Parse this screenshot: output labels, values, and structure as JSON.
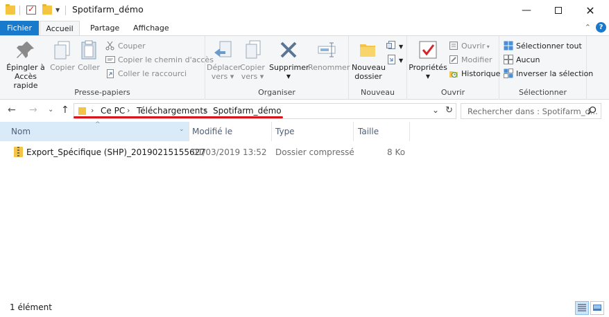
{
  "window": {
    "title": "Spotifarm_démo",
    "minimize_icon": "minimize-icon",
    "maximize_icon": "maximize-icon",
    "close_icon": "close-icon"
  },
  "ribbon_tabs": {
    "file": "Fichier",
    "home": "Accueil",
    "share": "Partage",
    "view": "Affichage"
  },
  "ribbon": {
    "clipboard": {
      "label": "Presse-papiers",
      "pin_line1": "Épingler à",
      "pin_line2": "Accès rapide",
      "copy": "Copier",
      "paste": "Coller",
      "cut": "Couper",
      "copy_path": "Copier le chemin d'accès",
      "paste_shortcut": "Coller le raccourci"
    },
    "organize": {
      "label": "Organiser",
      "move_line1": "Déplacer",
      "move_line2": "vers",
      "copyto_line1": "Copier",
      "copyto_line2": "vers",
      "delete": "Supprimer",
      "rename": "Renommer"
    },
    "new": {
      "label": "Nouveau",
      "new_folder_line1": "Nouveau",
      "new_folder_line2": "dossier"
    },
    "open": {
      "label": "Ouvrir",
      "properties": "Propriétés",
      "open": "Ouvrir",
      "edit": "Modifier",
      "history": "Historique"
    },
    "select": {
      "label": "Sélectionner",
      "select_all": "Sélectionner tout",
      "select_none": "Aucun",
      "invert": "Inverser la sélection"
    }
  },
  "address_bar": {
    "breadcrumb": [
      "Ce PC",
      "Téléchargements",
      "Spotifarm_démo"
    ],
    "search_placeholder": "Rechercher dans : Spotifarm_d..."
  },
  "columns": {
    "name": "Nom",
    "modified": "Modifié le",
    "type": "Type",
    "size": "Taille"
  },
  "files": [
    {
      "name": "Export_Spécifique (SHP)_20190215155627",
      "modified": "01/03/2019 13:52",
      "type": "Dossier compressé",
      "size": "8 Ko",
      "icon": "zip-folder-icon"
    }
  ],
  "status_bar": {
    "count": "1 élément"
  },
  "colors": {
    "accent": "#1979ca",
    "highlight_underline": "#d6161b",
    "folder": "#f5c542",
    "header_selected": "#d9ebf9"
  }
}
